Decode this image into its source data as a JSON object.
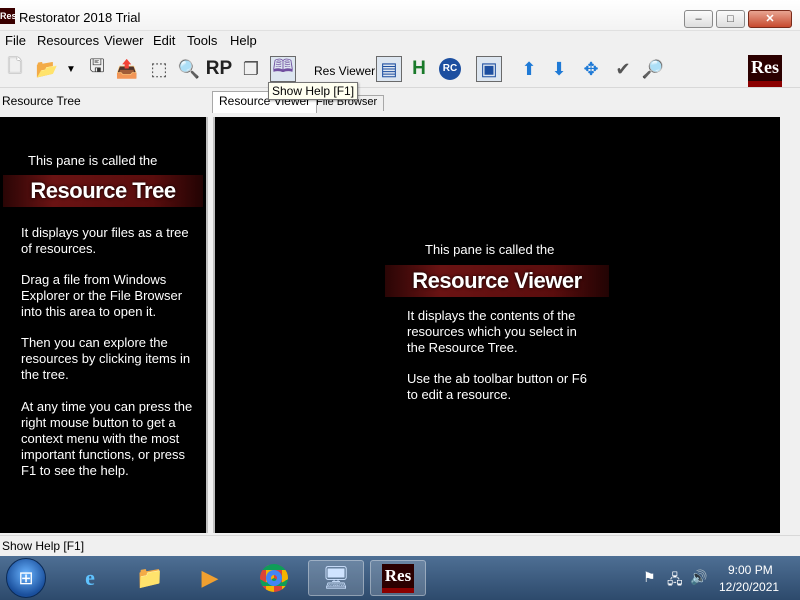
{
  "window": {
    "app_icon_text": "Res",
    "title": "Restorator 2018 Trial",
    "min_icon": "minimize-icon",
    "max_icon": "maximize-icon",
    "close_icon": "close-icon"
  },
  "menu": [
    "File",
    "Resources",
    "Viewer",
    "Edit",
    "Tools",
    "Help"
  ],
  "toolbar": {
    "res_viewer_label": "Res Viewer:",
    "rp_text": "RP",
    "h_text": "H",
    "rc_text": "RC",
    "logo_text": "Res",
    "tooltip": "Show Help [F1]"
  },
  "left_header": "Resource Tree",
  "tabs": [
    "Resource Viewer",
    "File Browser"
  ],
  "left_pane": {
    "heading": "This pane is called the",
    "banner": "Resource Tree",
    "p1": "It displays your files as a tree of resources.",
    "p2": "Drag a file from Windows Explorer or the File Browser into this area to open it.",
    "p3": "Then you can explore the resources by clicking items in the tree.",
    "p4": "At any time you can press the right mouse button to get a context menu with the most important functions, or press F1 to see the help."
  },
  "right_pane": {
    "heading": "This pane is called the",
    "banner": "Resource Viewer",
    "p1": "It displays the contents of the resources which you select in the Resource Tree.",
    "p2": "Use the ab toolbar button or F6 to edit a resource."
  },
  "status": "Show Help [F1]",
  "taskbar": {
    "res_text": "Res",
    "time": "9:00 PM",
    "date": "12/20/2021"
  },
  "colors": {
    "pane_background": "#000000",
    "banner_red": "#6a1313",
    "taskbar_blue": "#2d4a6c"
  }
}
